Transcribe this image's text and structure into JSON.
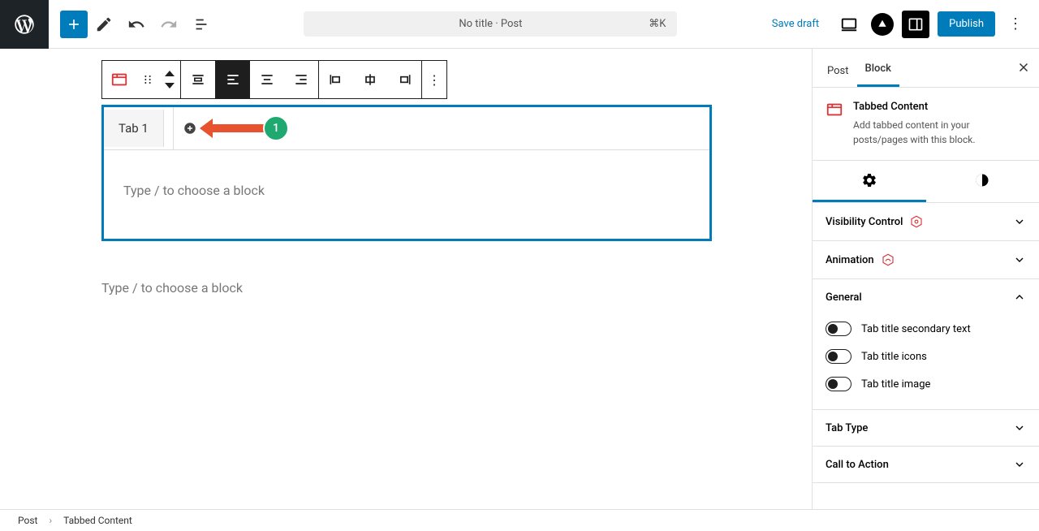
{
  "header": {
    "doc_title": "No title · Post",
    "shortcut": "⌘K",
    "save_draft": "Save draft",
    "publish": "Publish"
  },
  "block_toolbar": {
    "icons": [
      "tabbed-block",
      "drag",
      "move-up-down",
      "align",
      "text-left",
      "text-center",
      "text-right",
      "justify-left",
      "justify-center",
      "justify-right",
      "more"
    ]
  },
  "tabbed": {
    "tab1": "Tab 1",
    "placeholder": "Type / to choose a block",
    "annotation_number": "1"
  },
  "sidebar": {
    "tabs": {
      "post": "Post",
      "block": "Block"
    },
    "block_name": "Tabbed Content",
    "block_desc": "Add tabbed content in your posts/pages with this block.",
    "panels": {
      "visibility": "Visibility Control",
      "animation": "Animation",
      "general": "General",
      "tab_type": "Tab Type",
      "call_to_action": "Call to Action"
    },
    "general_toggles": {
      "secondary_text": "Tab title secondary text",
      "icons": "Tab title icons",
      "image": "Tab title image"
    }
  },
  "breadcrumb": {
    "root": "Post",
    "current": "Tabbed Content"
  }
}
